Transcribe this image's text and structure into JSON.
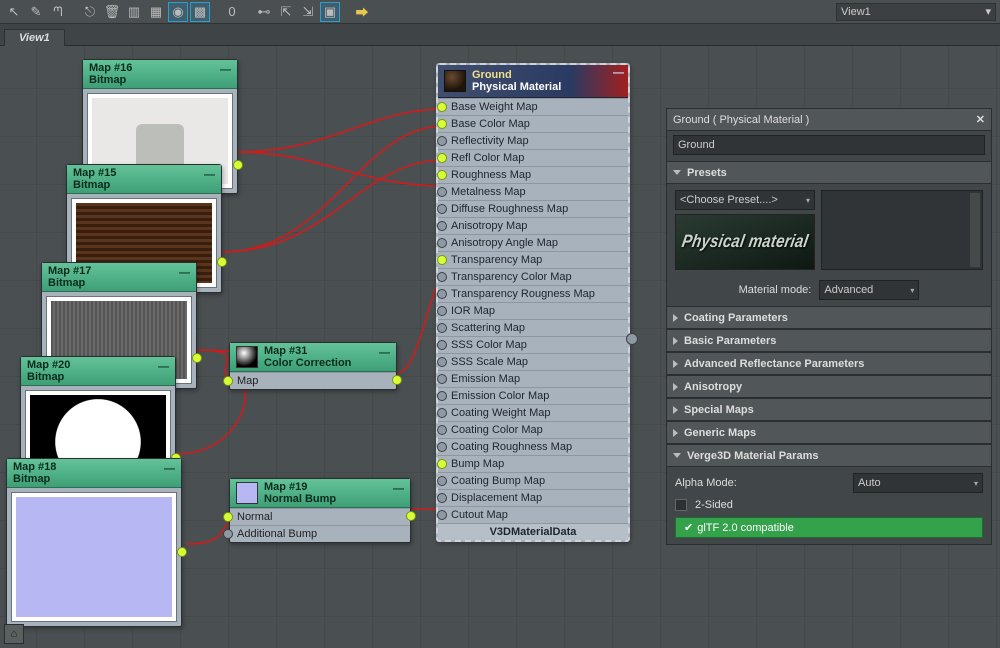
{
  "toolbar": {
    "view_selector": "View1"
  },
  "tab": {
    "label": "View1"
  },
  "nodes": {
    "map16": {
      "title": "Map #16",
      "type": "Bitmap"
    },
    "map15": {
      "title": "Map #15",
      "type": "Bitmap"
    },
    "map17": {
      "title": "Map #17",
      "type": "Bitmap"
    },
    "map20": {
      "title": "Map #20",
      "type": "Bitmap"
    },
    "map18": {
      "title": "Map #18",
      "type": "Bitmap"
    },
    "map31": {
      "title": "Map #31",
      "type": "Color Correction",
      "input_label": "Map"
    },
    "map19": {
      "title": "Map #19",
      "type": "Normal Bump",
      "inputs": {
        "normal": "Normal",
        "additional": "Additional Bump"
      }
    }
  },
  "material_node": {
    "title": "Ground",
    "subtitle": "Physical Material",
    "footer": "V3DMaterialData",
    "slots": [
      {
        "label": "Base Weight Map",
        "connected": true
      },
      {
        "label": "Base Color Map",
        "connected": true
      },
      {
        "label": "Reflectivity Map",
        "connected": false
      },
      {
        "label": "Refl Color Map",
        "connected": true
      },
      {
        "label": "Roughness Map",
        "connected": true
      },
      {
        "label": "Metalness Map",
        "connected": false
      },
      {
        "label": "Diffuse Roughness Map",
        "connected": false
      },
      {
        "label": "Anisotropy Map",
        "connected": false
      },
      {
        "label": "Anisotropy Angle Map",
        "connected": false
      },
      {
        "label": "Transparency Map",
        "connected": true
      },
      {
        "label": "Transparency Color Map",
        "connected": false
      },
      {
        "label": "Transparency Rougness Map",
        "connected": false
      },
      {
        "label": "IOR Map",
        "connected": false
      },
      {
        "label": "Scattering Map",
        "connected": false
      },
      {
        "label": "SSS Color Map",
        "connected": false
      },
      {
        "label": "SSS Scale Map",
        "connected": false
      },
      {
        "label": "Emission Map",
        "connected": false
      },
      {
        "label": "Emission Color Map",
        "connected": false
      },
      {
        "label": "Coating Weight Map",
        "connected": false
      },
      {
        "label": "Coating Color Map",
        "connected": false
      },
      {
        "label": "Coating Roughness Map",
        "connected": false
      },
      {
        "label": "Bump Map",
        "connected": true
      },
      {
        "label": "Coating Bump Map",
        "connected": false
      },
      {
        "label": "Displacement Map",
        "connected": false
      },
      {
        "label": "Cutout Map",
        "connected": false
      }
    ]
  },
  "panel": {
    "title": "Ground  ( Physical Material )",
    "name_field": "Ground",
    "presets": {
      "header": "Presets",
      "choose": "<Choose Preset....>",
      "thumb_text": "Physical material",
      "mode_label": "Material mode:",
      "mode_value": "Advanced"
    },
    "sections": {
      "coating": "Coating Parameters",
      "basic": "Basic Parameters",
      "arp": "Advanced Reflectance Parameters",
      "aniso": "Anisotropy",
      "special": "Special Maps",
      "generic": "Generic Maps",
      "v3d": "Verge3D Material Params"
    },
    "v3d": {
      "alpha_label": "Alpha Mode:",
      "alpha_value": "Auto",
      "twosided": "2-Sided",
      "gltf": "glTF 2.0 compatible"
    }
  }
}
